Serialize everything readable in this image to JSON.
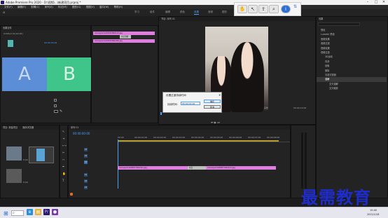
{
  "window": {
    "title": "Adobe Premiere Pro 2020 - D:\\视频\\...\\新建项目.prproj *",
    "min": "–",
    "max": "□",
    "close": "✕"
  },
  "menu": [
    "文件(F)",
    "编辑(E)",
    "剪辑(C)",
    "序列(S)",
    "标记(M)",
    "图形(G)",
    "视图(V)",
    "窗口(W)",
    "帮助(H)"
  ],
  "workspaces": [
    "学习",
    "组件",
    "编辑",
    "颜色",
    "效果",
    "音频",
    "图形",
    "库"
  ],
  "workspace_active": "效果",
  "effect_controls": {
    "header": "效果控件",
    "source": "Untitled 01(22:00)",
    "clip_a": "A",
    "clip_b": "B",
    "timecode": "00:00:05:00"
  },
  "timeline_mini": {
    "clip1": "mmexport1234567890123.jpg",
    "clip2": "mmexport1234567890456.jpg",
    "transition": "交叉溶解"
  },
  "program": {
    "header": "节目: 序列 01",
    "timecode": "00:00:00:00",
    "duration": "00:00:10:00",
    "fit": "适合",
    "full": "完整"
  },
  "dialog": {
    "title": "设置过渡持续时间",
    "label": "持续时间:",
    "value": "00:00:01:00",
    "ok": "确定",
    "cancel": "取消"
  },
  "toolbar_icons": [
    "hand-icon",
    "pointer-icon",
    "export-icon",
    "zoom-icon",
    "info-icon"
  ],
  "effects_panel": {
    "header": "效果",
    "items": [
      "预设",
      "Lumetri 预设",
      "音频效果",
      "音频过渡",
      "视频效果",
      "视频过渡",
      "3D运动",
      "内滑",
      "划像",
      "擦除",
      "沉浸式视频",
      "溶解",
      "交叉溶解",
      "交叉缩放"
    ],
    "selected": "溶解"
  },
  "project": {
    "header": "项目: 新建项目",
    "tab2": "媒体浏览器",
    "items": [
      {
        "name": "mmexport...jpg",
        "duration": "5:00"
      },
      {
        "name": "序列 01",
        "duration": "10:00"
      },
      {
        "name": "mmexport...jpg",
        "duration": "5:00"
      }
    ]
  },
  "timeline": {
    "header": "序列 01",
    "timecode": "00:00:00:00",
    "ruler": [
      "00:00",
      "00:00:01:00",
      "00:00:02:00",
      "00:00:03:00",
      "00:00:04:00",
      "00:00:05:00",
      "00:00:06:00",
      "00:00:07:00",
      "00:00:08:00",
      "00:00:09:00"
    ],
    "tracks": [
      "V3",
      "V2",
      "V1",
      "A1",
      "A2",
      "A3"
    ],
    "clip1": "mmexport1638877954321.jpg",
    "clip2": "mmexport1638877954123.jpg",
    "transition": "交叉"
  },
  "watermark": "最需教育",
  "taskbar": {
    "search": "",
    "time": "15:46",
    "date": "2021/12/8"
  },
  "colors": {
    "clip": "#e07de0",
    "accent": "#4aa0ff",
    "clip_a": "#5b8ed6",
    "clip_b": "#3fc58a",
    "watermark": "#1e2ccc"
  }
}
